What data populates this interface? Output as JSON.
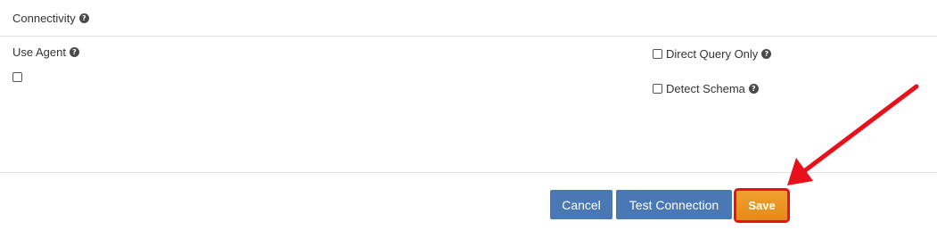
{
  "connectivity": {
    "title": "Connectivity",
    "help_icon": "question-circle-icon"
  },
  "use_agent": {
    "label": "Use Agent",
    "help_icon": "question-circle-icon",
    "checked": false
  },
  "options": {
    "direct_query_only": {
      "label": "Direct Query Only",
      "checked": false,
      "help_icon": "question-circle-icon"
    },
    "detect_schema": {
      "label": "Detect Schema",
      "checked": false,
      "help_icon": "question-circle-icon"
    }
  },
  "actions": {
    "cancel_label": "Cancel",
    "test_connection_label": "Test Connection",
    "save_label": "Save"
  },
  "colors": {
    "primary_button": "#4a78b4",
    "save_button": "#e8911d",
    "annotation": "#e8101a"
  }
}
